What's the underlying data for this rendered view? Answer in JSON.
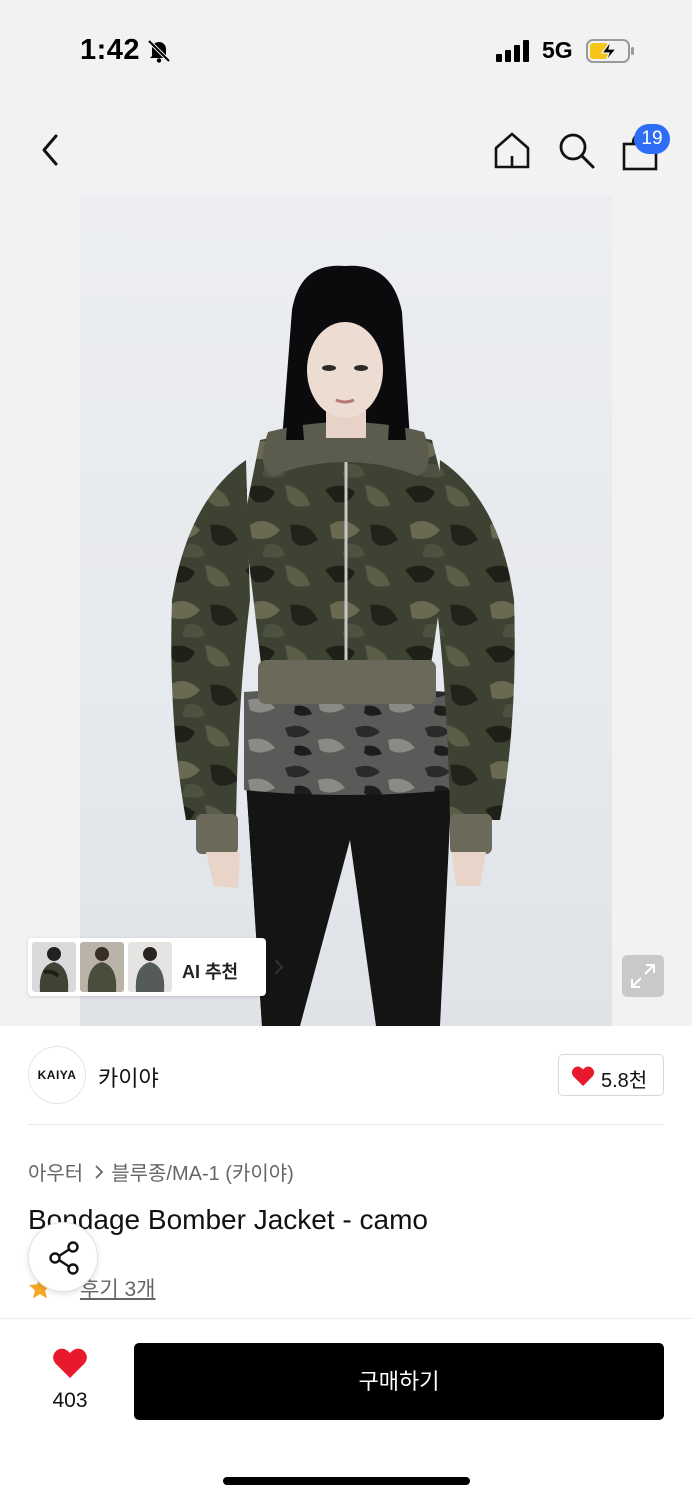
{
  "status_bar": {
    "time": "1:42",
    "network": "5G",
    "silent_icon": "bell-slash-icon",
    "signal_icon": "signal-bars-icon",
    "battery_icon": "battery-charging-icon"
  },
  "nav": {
    "back_icon": "chevron-left-icon",
    "home_icon": "home-icon",
    "search_icon": "search-icon",
    "bag_icon": "shopping-bag-icon",
    "bag_badge": "19",
    "badge_color": "#2f6df6"
  },
  "hero": {
    "ai_recommend_label": "AI 추천",
    "expand_icon": "expand-icon"
  },
  "brand": {
    "logo_text": "KAIYA",
    "name": "카이야",
    "like_count": "5.8천",
    "heart_color": "#e8192c"
  },
  "product": {
    "breadcrumb": [
      "아우터",
      "블루종/MA-1 (카이야)"
    ],
    "title": "Bondage Bomber Jacket - camo",
    "review_link": "후기 3개",
    "star_color": "#f5a623"
  },
  "bottom": {
    "like_count": "403",
    "buy_label": "구매하기",
    "buy_color": "#000000"
  }
}
